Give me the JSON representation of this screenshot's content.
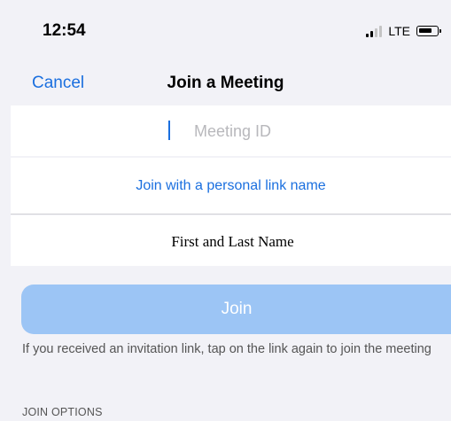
{
  "status_bar": {
    "time": "12:54",
    "network": "LTE",
    "icons": [
      "signal-icon",
      "battery-icon"
    ]
  },
  "nav": {
    "cancel_label": "Cancel",
    "title": "Join a Meeting"
  },
  "meeting_id": {
    "placeholder": "Meeting ID",
    "value": ""
  },
  "personal_link": {
    "label": "Join with a personal link name"
  },
  "name_field": {
    "placeholder": "First and Last Name",
    "value": ""
  },
  "join": {
    "label": "Join",
    "color": "#9cc5f5"
  },
  "hint": "If you received an invitation link, tap on the link again to join the meeting",
  "section": {
    "join_options": "JOIN OPTIONS"
  },
  "colors": {
    "accent": "#1a6fdf",
    "background": "#f2f2f7"
  }
}
